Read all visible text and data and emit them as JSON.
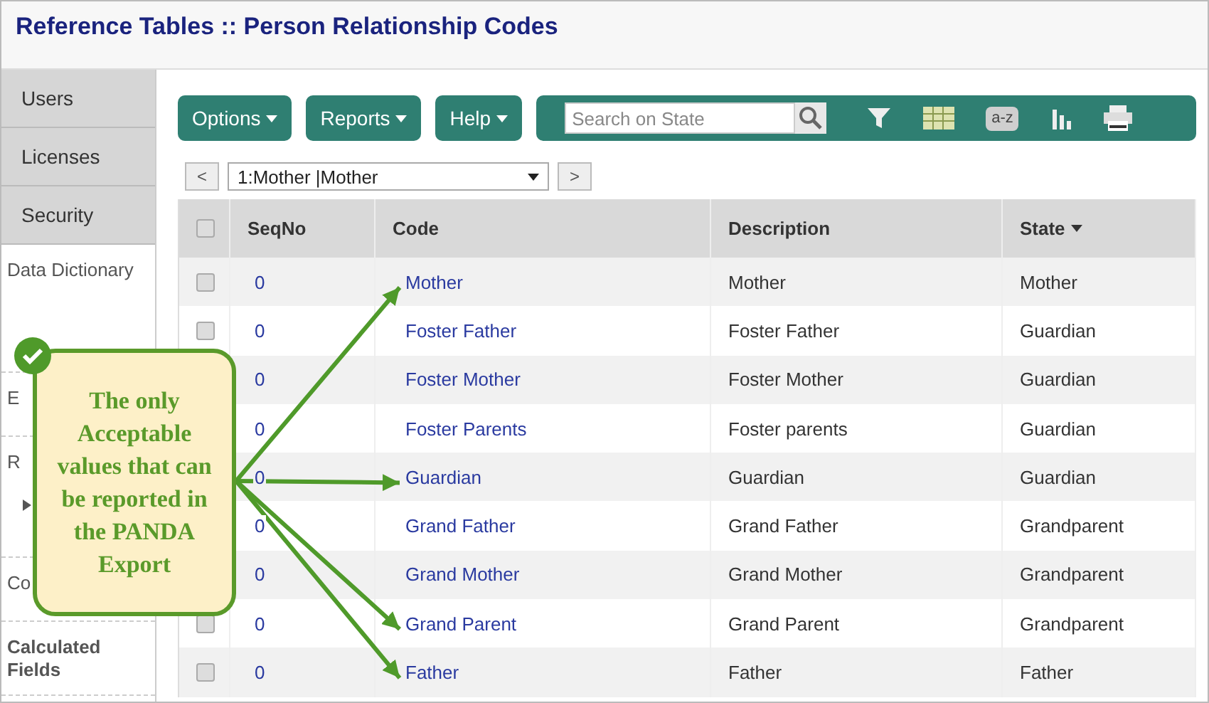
{
  "title": "Reference Tables :: Person Relationship Codes",
  "sidebar": {
    "tabs": [
      {
        "label": "Users"
      },
      {
        "label": "Licenses"
      },
      {
        "label": "Security"
      }
    ],
    "items": [
      {
        "label": "Data Dictionary",
        "kind": "plain"
      },
      {
        "label": "E",
        "kind": "plain"
      },
      {
        "label": "R",
        "kind": "expander"
      },
      {
        "label": "Co",
        "kind": "plain"
      },
      {
        "label": "Calculated Fields",
        "kind": "bold"
      }
    ]
  },
  "toolbar": {
    "menus": [
      "Options",
      "Reports",
      "Help"
    ],
    "search": {
      "placeholder": "Search on State"
    },
    "sort_label": "a-z"
  },
  "navigator": {
    "prev": "<",
    "value": "1:Mother |Mother",
    "next": ">"
  },
  "table": {
    "select_all_checked": false,
    "columns": [
      {
        "label": "SeqNo",
        "sorted": false
      },
      {
        "label": "Code",
        "sorted": false
      },
      {
        "label": "Description",
        "sorted": false
      },
      {
        "label": "State",
        "sorted": true
      }
    ],
    "rows": [
      {
        "seq": "0",
        "code": "Mother",
        "description": "Mother",
        "state": "Mother",
        "checked": false,
        "pointed": true
      },
      {
        "seq": "0",
        "code": "Foster Father",
        "description": "Foster Father",
        "state": "Guardian",
        "checked": false,
        "pointed": false
      },
      {
        "seq": "0",
        "code": "Foster Mother",
        "description": "Foster Mother",
        "state": "Guardian",
        "pointed": false
      },
      {
        "seq": "0",
        "code": "Foster Parents",
        "description": "Foster parents",
        "state": "Guardian",
        "pointed": false
      },
      {
        "seq": "0",
        "code": "Guardian",
        "description": "Guardian",
        "state": "Guardian",
        "pointed": true
      },
      {
        "seq": "0",
        "code": "Grand Father",
        "description": "Grand Father",
        "state": "Grandparent",
        "pointed": false
      },
      {
        "seq": "0",
        "code": "Grand Mother",
        "description": "Grand Mother",
        "state": "Grandparent",
        "pointed": false
      },
      {
        "seq": "0",
        "code": "Grand Parent",
        "description": "Grand Parent",
        "state": "Grandparent",
        "checked": false,
        "pointed": true
      },
      {
        "seq": "0",
        "code": "Father",
        "description": "Father",
        "state": "Father",
        "checked": false,
        "pointed": true
      }
    ]
  },
  "callout": {
    "text": "The only Acceptable values that can be reported in the PANDA Export"
  }
}
